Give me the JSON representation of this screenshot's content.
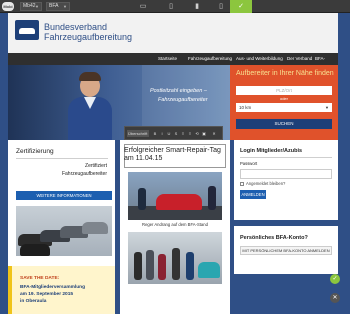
{
  "toolbar": {
    "logo": "Mobi",
    "site_select": "Mb42",
    "lang_select": "BFA",
    "devices": [
      "desktop-icon",
      "tablet-icon",
      "mobile-icon",
      "phone-icon",
      "check-icon"
    ]
  },
  "brand": {
    "line1": "Bundesverband",
    "line2": "Fahrzeugaufbereitung"
  },
  "nav": [
    "Startseite",
    "Fahrzeugaufbereitung",
    "Aus- und Weiterbildung",
    "Der Verband",
    "BFA-Kontakt"
  ],
  "hero": {
    "line1": "Postleitzahl eingeben –",
    "line2": "Fahrzeugaufbereiter"
  },
  "finder": {
    "title": "Aufbereiter in Ihrer Nähe finden",
    "zip_placeholder": "PLZ/Ort",
    "or_text": "oder",
    "radius": "10 km",
    "button": "SUCHEN"
  },
  "certification": {
    "title": "Zertifizierung",
    "line1": "Zertifiziert",
    "line2": "Fahrzeugaufbereiter",
    "button": "WEITERE INFORMATIONEN"
  },
  "editor": {
    "dropdown": "Überschrift",
    "buttons": [
      "B",
      "I",
      "U",
      "S",
      "≡",
      "≡",
      "⟲",
      "▣",
      "✕"
    ]
  },
  "article": {
    "title": "Erfolgreicher Smart-Repair-Tag am 11.04.15",
    "caption": "Reger Andrang auf dem BFA-Stand"
  },
  "save_date": {
    "title": "SAVE THE DATE:",
    "line1": "BFA-Mitgliederversammlung",
    "line2": "am 19. September 2015",
    "line3": "in Oberaula"
  },
  "login": {
    "title": "Login Mitglieder/Azubis",
    "password_label": "Passwort",
    "remember_label": "Angemeldet bleiben?",
    "button": "ANMELDEN"
  },
  "bfa_box": {
    "title": "Persönliches BFA-Konto?",
    "button": "MIT PERSÖNLICHEM BFA-KONTO ANMELDEN"
  },
  "colors": {
    "blue": "#2f4f86",
    "orange": "#e0522b",
    "green": "#8cc63e",
    "accent": "#1d5fb0"
  }
}
